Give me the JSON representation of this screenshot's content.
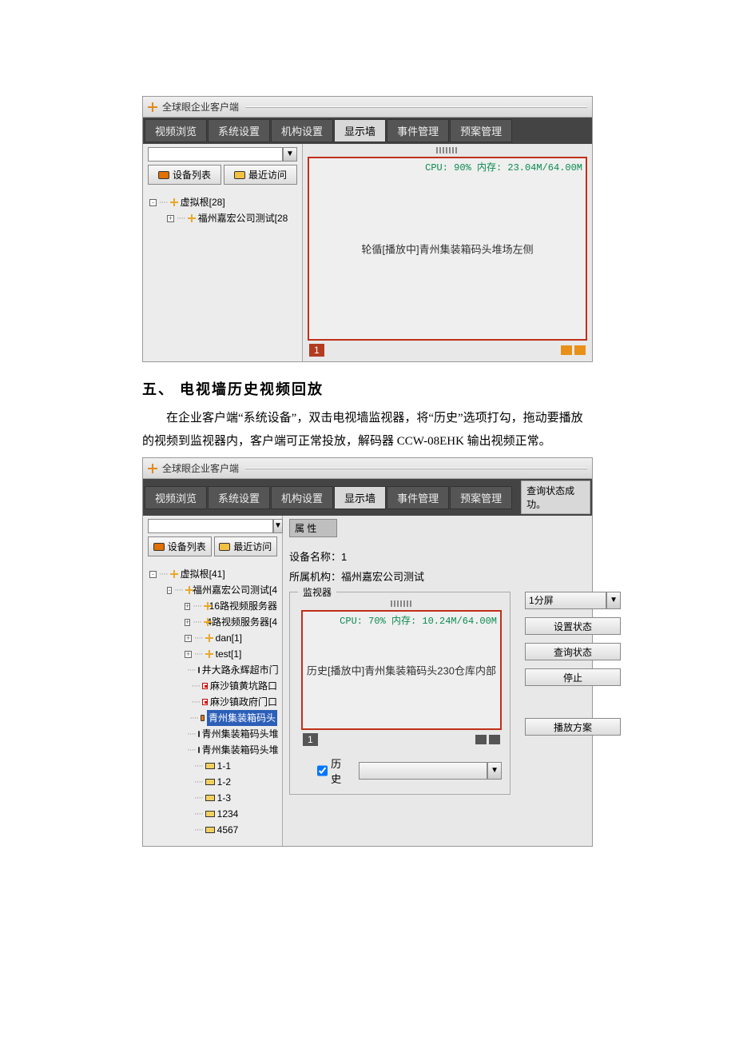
{
  "colors": {
    "accent_red": "#c03018",
    "stat_green": "#0a8a50",
    "orange": "#e89018"
  },
  "app1": {
    "title": "全球眼企业客户端",
    "menus": [
      "视频浏览",
      "系统设置",
      "机构设置",
      "显示墙",
      "事件管理",
      "预案管理"
    ],
    "active_menu": 3,
    "side_tabs": {
      "devices": "设备列表",
      "recent": "最近访问"
    },
    "tree": [
      {
        "ind": 0,
        "tog": "-",
        "icon": "cross",
        "label": "虚拟根[28]"
      },
      {
        "ind": 1,
        "tog": "+",
        "icon": "cross",
        "label": "福州嘉宏公司测试[28"
      }
    ],
    "video": {
      "stats": "CPU: 90% 内存: 23.04M/64.00M",
      "center": "轮循[播放中]青州集装箱码头堆场左侧",
      "index": "1"
    }
  },
  "doc": {
    "heading": "五、 电视墙历史视频回放",
    "para": "在企业客户端“系统设备”，双击电视墙监视器，将“历史”选项打勾，拖动要播放的视频到监视器内，客户端可正常投放，解码器 CCW-08EHK 输出视频正常。"
  },
  "app2": {
    "title": "全球眼企业客户端",
    "menus": [
      "视频浏览",
      "系统设置",
      "机构设置",
      "显示墙",
      "事件管理",
      "预案管理"
    ],
    "active_menu": 3,
    "status_msg": "查询状态成功。",
    "side_tabs": {
      "devices": "设备列表",
      "recent": "最近访问"
    },
    "tree": [
      {
        "ind": 0,
        "tog": "-",
        "icon": "cross",
        "label": "虚拟根[41]"
      },
      {
        "ind": 1,
        "tog": "-",
        "icon": "cross",
        "label": "福州嘉宏公司测试[4"
      },
      {
        "ind": 2,
        "tog": "+",
        "icon": "cross",
        "label": "16路视频服务器"
      },
      {
        "ind": 2,
        "tog": "+",
        "icon": "cross",
        "label": "4路视频服务器[4"
      },
      {
        "ind": 2,
        "tog": "+",
        "icon": "cross",
        "label": "dan[1]"
      },
      {
        "ind": 2,
        "tog": "+",
        "icon": "cross",
        "label": "test[1]"
      },
      {
        "ind": 2,
        "tog": "",
        "icon": "cam",
        "label": "井大路永辉超市门"
      },
      {
        "ind": 2,
        "tog": "",
        "icon": "camred",
        "label": "麻沙镇黄坑路口"
      },
      {
        "ind": 2,
        "tog": "",
        "icon": "camred",
        "label": "麻沙镇政府门口"
      },
      {
        "ind": 2,
        "tog": "",
        "icon": "cam",
        "label": "青州集装箱码头",
        "sel": true
      },
      {
        "ind": 2,
        "tog": "",
        "icon": "cam",
        "label": "青州集装箱码头堆"
      },
      {
        "ind": 2,
        "tog": "",
        "icon": "cam",
        "label": "青州集装箱码头堆"
      },
      {
        "ind": 2,
        "tog": "",
        "icon": "plan",
        "label": "1-1"
      },
      {
        "ind": 2,
        "tog": "",
        "icon": "plan",
        "label": "1-2"
      },
      {
        "ind": 2,
        "tog": "",
        "icon": "plan",
        "label": "1-3"
      },
      {
        "ind": 2,
        "tog": "",
        "icon": "plan",
        "label": "1234"
      },
      {
        "ind": 2,
        "tog": "",
        "icon": "plan",
        "label": "4567"
      }
    ],
    "props": {
      "title": "属 性",
      "dev_name_lbl": "设备名称：",
      "dev_name_val": "1",
      "org_lbl": "所属机构：",
      "org_val": "福州嘉宏公司测试",
      "monitor_legend": "监视器",
      "stats": "CPU: 70% 内存: 10.24M/64.00M",
      "center": "历史[播放中]青州集装箱码头230仓库内部",
      "index": "1",
      "screen_select": "1分屏",
      "btn_set": "设置状态",
      "btn_query": "查询状态",
      "btn_stop": "停止",
      "btn_play": "播放方案",
      "hist_label": "历史",
      "hist_checked": true
    }
  }
}
